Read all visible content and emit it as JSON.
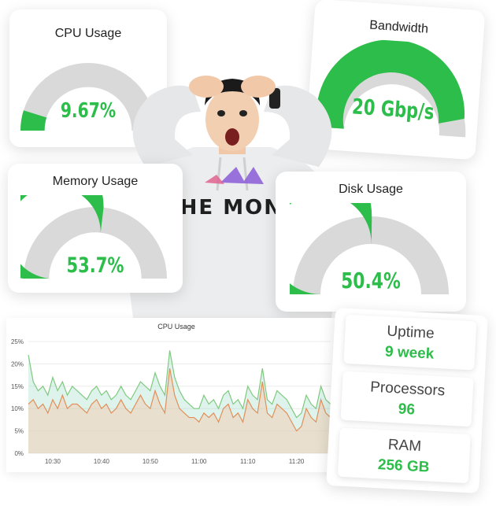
{
  "gauges": {
    "cpu": {
      "title": "CPU Usage",
      "value": "9.67%",
      "fraction": 0.0967
    },
    "bandwidth": {
      "title": "Bandwidth",
      "value": "20 Gbp/s",
      "fraction": 0.92
    },
    "memory": {
      "title": "Memory Usage",
      "value": "53.7%",
      "fraction": 0.537
    },
    "disk": {
      "title": "Disk Usage",
      "value": "50.4%",
      "fraction": 0.504
    }
  },
  "person": {
    "shirt_text": "THE MONA"
  },
  "stats": {
    "uptime": {
      "label": "Uptime",
      "value": "9 week"
    },
    "processors": {
      "label": "Processors",
      "value": "96"
    },
    "ram": {
      "label": "RAM",
      "value": "256 GB"
    }
  },
  "colors": {
    "accent": "#2dbd4a",
    "track": "#d9d9d9",
    "line_green": "#7fc97f",
    "line_orange": "#e0905a"
  },
  "chart_data": {
    "type": "area",
    "title": "CPU Usage",
    "xlabel": "",
    "ylabel": "",
    "x_ticks": [
      "10:30",
      "10:40",
      "10:50",
      "11:00",
      "11:10",
      "11:20"
    ],
    "y_ticks": [
      "0%",
      "5%",
      "10%",
      "15%",
      "20%",
      "25%"
    ],
    "ylim": [
      0,
      25
    ],
    "x": [
      "10:25",
      "10:26",
      "10:27",
      "10:28",
      "10:29",
      "10:30",
      "10:31",
      "10:32",
      "10:33",
      "10:34",
      "10:35",
      "10:36",
      "10:37",
      "10:38",
      "10:39",
      "10:40",
      "10:41",
      "10:42",
      "10:43",
      "10:44",
      "10:45",
      "10:46",
      "10:47",
      "10:48",
      "10:49",
      "10:50",
      "10:51",
      "10:52",
      "10:53",
      "10:54",
      "10:55",
      "10:56",
      "10:57",
      "10:58",
      "10:59",
      "11:00",
      "11:01",
      "11:02",
      "11:03",
      "11:04",
      "11:05",
      "11:06",
      "11:07",
      "11:08",
      "11:09",
      "11:10",
      "11:11",
      "11:12",
      "11:13",
      "11:14",
      "11:15",
      "11:16",
      "11:17",
      "11:18",
      "11:19",
      "11:20",
      "11:21",
      "11:22",
      "11:23",
      "11:24",
      "11:25",
      "11:26",
      "11:27"
    ],
    "series": [
      {
        "values": [
          22,
          16,
          14,
          15,
          13,
          17,
          14,
          16,
          13,
          15,
          14,
          13,
          12,
          14,
          15,
          13,
          14,
          12,
          13,
          15,
          13,
          12,
          14,
          16,
          15,
          14,
          18,
          15,
          13,
          23,
          17,
          14,
          12,
          11,
          10,
          10,
          13,
          11,
          12,
          10,
          13,
          14,
          11,
          12,
          10,
          15,
          13,
          12,
          19,
          12,
          11,
          14,
          13,
          12,
          10,
          8,
          9,
          13,
          11,
          10,
          15,
          12,
          11
        ]
      },
      {
        "values": [
          11,
          12,
          10,
          11,
          9,
          12,
          10,
          13,
          10,
          11,
          11,
          10,
          9,
          11,
          12,
          10,
          11,
          9,
          10,
          12,
          10,
          9,
          11,
          13,
          11,
          10,
          14,
          11,
          9,
          19,
          13,
          10,
          9,
          8,
          8,
          7,
          9,
          8,
          9,
          7,
          10,
          11,
          8,
          9,
          7,
          12,
          10,
          9,
          16,
          9,
          8,
          11,
          10,
          9,
          7,
          5,
          6,
          10,
          8,
          7,
          12,
          9,
          8
        ]
      }
    ]
  }
}
